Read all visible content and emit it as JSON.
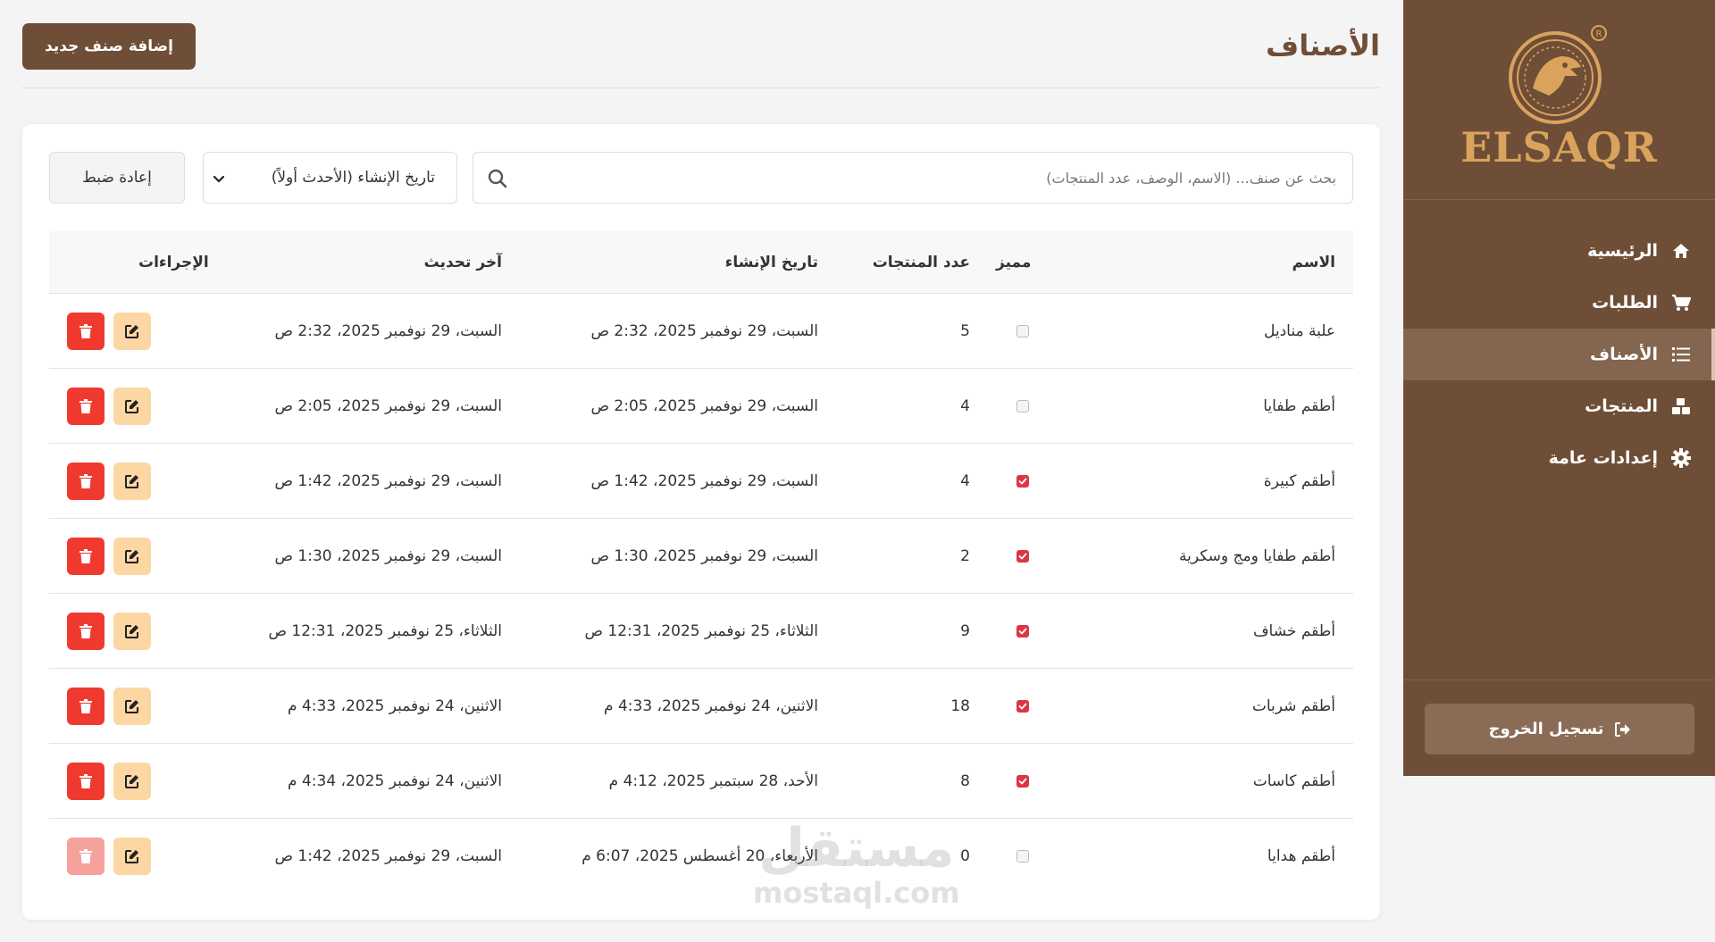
{
  "sidebar": {
    "brand": "ELSAQR",
    "items": [
      {
        "label": "الرئيسية",
        "icon": "home-icon"
      },
      {
        "label": "الطلبات",
        "icon": "cart-icon"
      },
      {
        "label": "الأصناف",
        "icon": "list-icon"
      },
      {
        "label": "المنتجات",
        "icon": "boxes-icon"
      },
      {
        "label": "إعدادات عامة",
        "icon": "gear-icon"
      }
    ],
    "active_index": 2,
    "logout_label": "تسجيل الخروج"
  },
  "header": {
    "title": "الأصناف",
    "add_button_label": "إضافة صنف جديد"
  },
  "filters": {
    "search_placeholder": "بحث عن صنف... (الاسم، الوصف، عدد المنتجات)",
    "sort_selected": "تاريخ الإنشاء (الأحدث أولاً)",
    "reset_label": "إعادة ضبط"
  },
  "table": {
    "headers": {
      "name": "الاسم",
      "featured": "مميز",
      "count": "عدد المنتجات",
      "created": "تاريخ الإنشاء",
      "updated": "آخر تحديث",
      "actions": "الإجراءات"
    },
    "rows": [
      {
        "name": "علبة مناديل",
        "featured": false,
        "count": "5",
        "created": "السبت، 29 نوفمبر 2025، 2:32 ص",
        "updated": "السبت، 29 نوفمبر 2025، 2:32 ص",
        "delete_disabled": false
      },
      {
        "name": "أطقم طفايا",
        "featured": false,
        "count": "4",
        "created": "السبت، 29 نوفمبر 2025، 2:05 ص",
        "updated": "السبت، 29 نوفمبر 2025، 2:05 ص",
        "delete_disabled": false
      },
      {
        "name": "أطقم كبيرة",
        "featured": true,
        "count": "4",
        "created": "السبت، 29 نوفمبر 2025، 1:42 ص",
        "updated": "السبت، 29 نوفمبر 2025، 1:42 ص",
        "delete_disabled": false
      },
      {
        "name": "أطقم طفايا ومج وسكرية",
        "featured": true,
        "count": "2",
        "created": "السبت، 29 نوفمبر 2025، 1:30 ص",
        "updated": "السبت، 29 نوفمبر 2025، 1:30 ص",
        "delete_disabled": false
      },
      {
        "name": "أطقم خشاف",
        "featured": true,
        "count": "9",
        "created": "الثلاثاء، 25 نوفمبر 2025، 12:31 ص",
        "updated": "الثلاثاء، 25 نوفمبر 2025، 12:31 ص",
        "delete_disabled": false
      },
      {
        "name": "أطقم شربات",
        "featured": true,
        "count": "18",
        "created": "الاثنين، 24 نوفمبر 2025، 4:33 م",
        "updated": "الاثنين، 24 نوفمبر 2025، 4:33 م",
        "delete_disabled": false
      },
      {
        "name": "أطقم كاسات",
        "featured": true,
        "count": "8",
        "created": "الأحد، 28 سبتمبر 2025، 4:12 م",
        "updated": "الاثنين، 24 نوفمبر 2025، 4:34 م",
        "delete_disabled": false
      },
      {
        "name": "أطقم هدايا",
        "featured": false,
        "count": "0",
        "created": "الأربعاء، 20 أغسطس 2025، 6:07 م",
        "updated": "السبت، 29 نوفمبر 2025، 1:42 ص",
        "delete_disabled": true
      }
    ]
  },
  "watermark": {
    "top": "مستقل",
    "bottom": "mostaql.com"
  },
  "colors": {
    "brand": "#6f4e37",
    "accent": "#d9a35c",
    "danger": "#f03a30",
    "edit": "#fcd7a4"
  }
}
